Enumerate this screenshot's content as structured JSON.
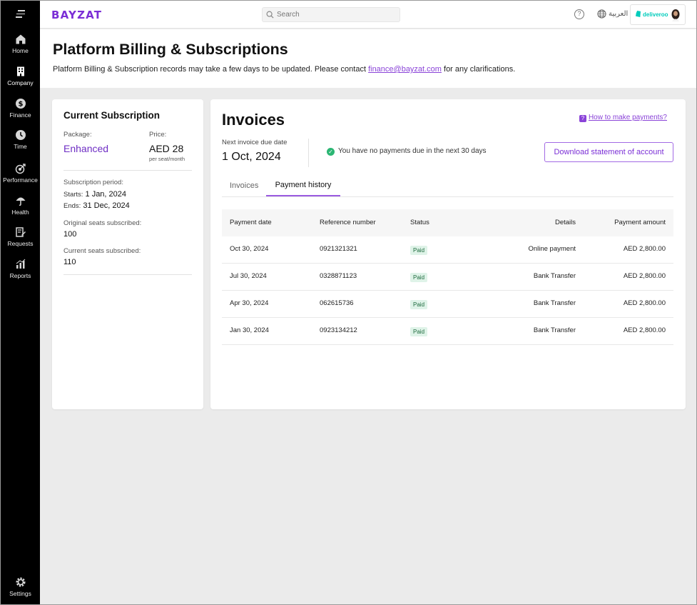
{
  "app": {
    "logo": "BAYZAT",
    "search_placeholder": "Search",
    "language": "العربية",
    "company": "deliveroo"
  },
  "sidebar": {
    "items": [
      {
        "label": "Home",
        "icon": "home-icon"
      },
      {
        "label": "Company",
        "icon": "building-icon"
      },
      {
        "label": "Finance",
        "icon": "dollar-icon"
      },
      {
        "label": "Time",
        "icon": "clock-icon"
      },
      {
        "label": "Performance",
        "icon": "target-icon"
      },
      {
        "label": "Health",
        "icon": "umbrella-icon"
      },
      {
        "label": "Requests",
        "icon": "edit-document-icon"
      },
      {
        "label": "Reports",
        "icon": "bar-chart-icon"
      }
    ],
    "settings_label": "Settings"
  },
  "header": {
    "title": "Platform Billing & Subscriptions",
    "subtitle_pre": "Platform Billing & Subscription records may take a few days to be updated. Please contact ",
    "email": "finance@bayzat.com",
    "subtitle_post": " for any clarifications."
  },
  "subscription": {
    "title": "Current Subscription",
    "package_label": "Package:",
    "package_value": "Enhanced",
    "price_label": "Price:",
    "price_value": "AED 28",
    "price_unit": "per seat/month",
    "period_label": "Subscription period:",
    "starts_label": "Starts:",
    "starts_value": "1 Jan, 2024",
    "ends_label": "Ends:",
    "ends_value": "31 Dec, 2024",
    "original_seats_label": "Original seats subscribed:",
    "original_seats_value": "100",
    "current_seats_label": "Current seats subscribed:",
    "current_seats_value": "110"
  },
  "invoices": {
    "title": "Invoices",
    "how_to_link": "How to make payments?",
    "next_due_label": "Next invoice due date",
    "next_due_value": "1 Oct, 2024",
    "no_payments_text": "You have no payments due in the next 30 days",
    "download_button": "Download statement of account",
    "tabs": [
      {
        "label": "Invoices",
        "active": false
      },
      {
        "label": "Payment history",
        "active": true
      }
    ],
    "columns": [
      "Payment date",
      "Reference number",
      "Status",
      "Details",
      "Payment amount"
    ],
    "rows": [
      {
        "date": "Oct 30, 2024",
        "ref": "0921321321",
        "status": "Paid",
        "details": "Online payment",
        "amount": "AED 2,800.00"
      },
      {
        "date": "Jul 30, 2024",
        "ref": "0328871123",
        "status": "Paid",
        "details": "Bank Transfer",
        "amount": "AED 2,800.00"
      },
      {
        "date": "Apr 30, 2024",
        "ref": "062615736",
        "status": "Paid",
        "details": "Bank Transfer",
        "amount": "AED 2,800.00"
      },
      {
        "date": "Jan 30, 2024",
        "ref": "0923134212",
        "status": "Paid",
        "details": "Bank Transfer",
        "amount": "AED 2,800.00"
      }
    ]
  },
  "colors": {
    "brand": "#7b2fd6",
    "sidebar_bg": "#000000",
    "success": "#2bb673",
    "paid_badge_bg": "#dff3e8"
  }
}
